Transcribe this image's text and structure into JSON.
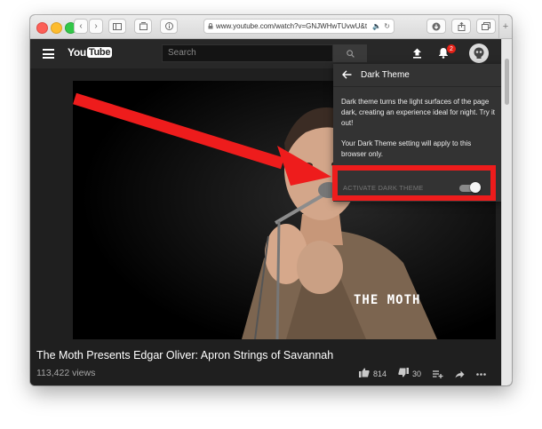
{
  "browser": {
    "url": "www.youtube.com/watch?v=GNJWHwTUvwU&t",
    "url_icon": "lock-icon",
    "audio_icon": "speaker-icon",
    "reload_icon": "reload-icon"
  },
  "youtube": {
    "logo_you": "You",
    "logo_tube": "Tube",
    "search_placeholder": "Search",
    "notification_count": "2"
  },
  "dark_theme_panel": {
    "title": "Dark Theme",
    "description": "Dark theme turns the light surfaces of the page dark, creating an experience ideal for night. Try it out!",
    "note": "Your Dark Theme setting will apply to this browser only.",
    "toggle_label": "ACTIVATE DARK THEME",
    "toggle_state": "on"
  },
  "video": {
    "watermark": "THE MOTH",
    "title": "The Moth Presents Edgar Oliver: Apron Strings of Savannah",
    "views": "113,422 views",
    "likes": "814",
    "dislikes": "30"
  },
  "colors": {
    "annotation_red": "#ee1c1c",
    "panel_bg": "#333333",
    "masthead_bg": "#282828",
    "notification_badge": "#e62117"
  }
}
